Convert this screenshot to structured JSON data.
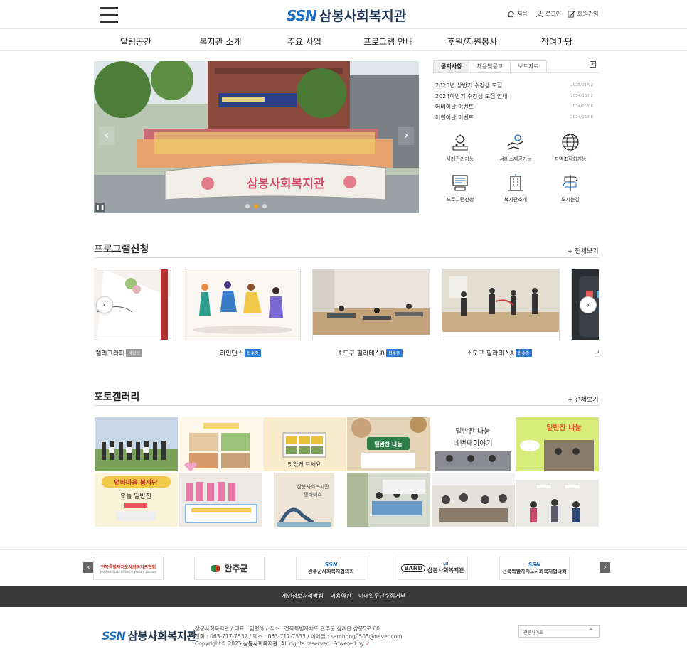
{
  "header": {
    "logo_ssn": "SSN",
    "logo_name": "삼봉사회복지관",
    "util": [
      {
        "label": "처음",
        "icon": "home-icon"
      },
      {
        "label": "로그인",
        "icon": "user-icon"
      },
      {
        "label": "회원가입",
        "icon": "edit-icon"
      }
    ]
  },
  "nav": [
    "알림공간",
    "복지관 소개",
    "주요 사업",
    "프로그램 안내",
    "후원/자원봉사",
    "참여마당"
  ],
  "notice": {
    "tabs": [
      "공지사항",
      "채용및공고",
      "보도자료"
    ],
    "more": "+",
    "items": [
      {
        "title": "2025년 상반기 수강생 모집",
        "date": "2025/01/02"
      },
      {
        "title": "2024하반기 수강생 모집 안내",
        "date": "2024/08/02"
      },
      {
        "title": "어버이날 이벤트",
        "date": "2024/05/08"
      },
      {
        "title": "어린이날 이벤트",
        "date": "2024/05/08"
      }
    ]
  },
  "slider": {
    "banner_text": "삼봉사회복지관",
    "sign_text": "삼봉사회복지관"
  },
  "quick_links": [
    {
      "label": "사례관리기능",
      "icon": "case-management-icon"
    },
    {
      "label": "서비스제공기능",
      "icon": "service-hands-icon"
    },
    {
      "label": "지역조직화기능",
      "icon": "globe-icon"
    },
    {
      "label": "프로그램신청",
      "icon": "program-board-icon"
    },
    {
      "label": "복지관소개",
      "icon": "building-icon"
    },
    {
      "label": "오시는길",
      "icon": "signpost-icon"
    }
  ],
  "programs": {
    "title": "프로그램신청",
    "more": "+ 전체보기",
    "items": [
      {
        "label": "캘리그라피",
        "badge": "마감됨",
        "status": "closed"
      },
      {
        "label": "라인댄스",
        "badge": "접수중",
        "status": "open"
      },
      {
        "label": "소도구 필라테스B",
        "badge": "접수중",
        "status": "open"
      },
      {
        "label": "소도구 필라테스A",
        "badge": "접수중",
        "status": "open"
      },
      {
        "label": "스",
        "badge": "",
        "status": "open"
      }
    ]
  },
  "gallery": {
    "title": "포토갤러리",
    "more": "+ 전체보기",
    "texts": [
      "밑반찬 나눔",
      "밑반찬 나눔",
      "네번째이야기",
      "밑반찬 나눔",
      "엄마마음 봉사단",
      "오늘 밑반찬",
      "맛있게 드세요",
      "삼봉사회복지관",
      "필라테스"
    ]
  },
  "partners": [
    "전북특별자치도사회복지관협회",
    "완주군",
    "완주군사회복지협의회",
    "삼봉사회복지관",
    "전북특별자치도사회복지협의회"
  ],
  "partner_sub": {
    "band": "BAND",
    "lh": "LH",
    "ssn": "SSN",
    "assoc_en": "Jeonbuk State of Social Welfare Centers"
  },
  "footer_links": [
    "개인정보처리방침",
    "이용약관",
    "이메일무단수집거부"
  ],
  "footer": {
    "logo_ssn": "SSN",
    "logo_name": "삼봉사회복지관",
    "line1": "삼봉사회복지관  /  대표 : 임평하  /  주소 : 전북특별자치도 완주군 삼례읍 삼봉5로 60",
    "line2": "전화 : 063-717-7532  /  팩스 : 063-717-7533  /  이메일 : sambong0503@naver.com",
    "line3_prefix": "Copyright© 2025 ",
    "line3_strong": "삼봉사회복지관",
    "line3_suffix": ". All rights reserved. Powered by",
    "related": "관련사이트",
    "related_caret": "^"
  },
  "colors": {
    "brand_blue": "#1d6fc1",
    "brand_green": "#7cc242",
    "badge_open": "#2a7bd1",
    "badge_closed": "#999999",
    "footer_bar": "#3a3a3a"
  }
}
